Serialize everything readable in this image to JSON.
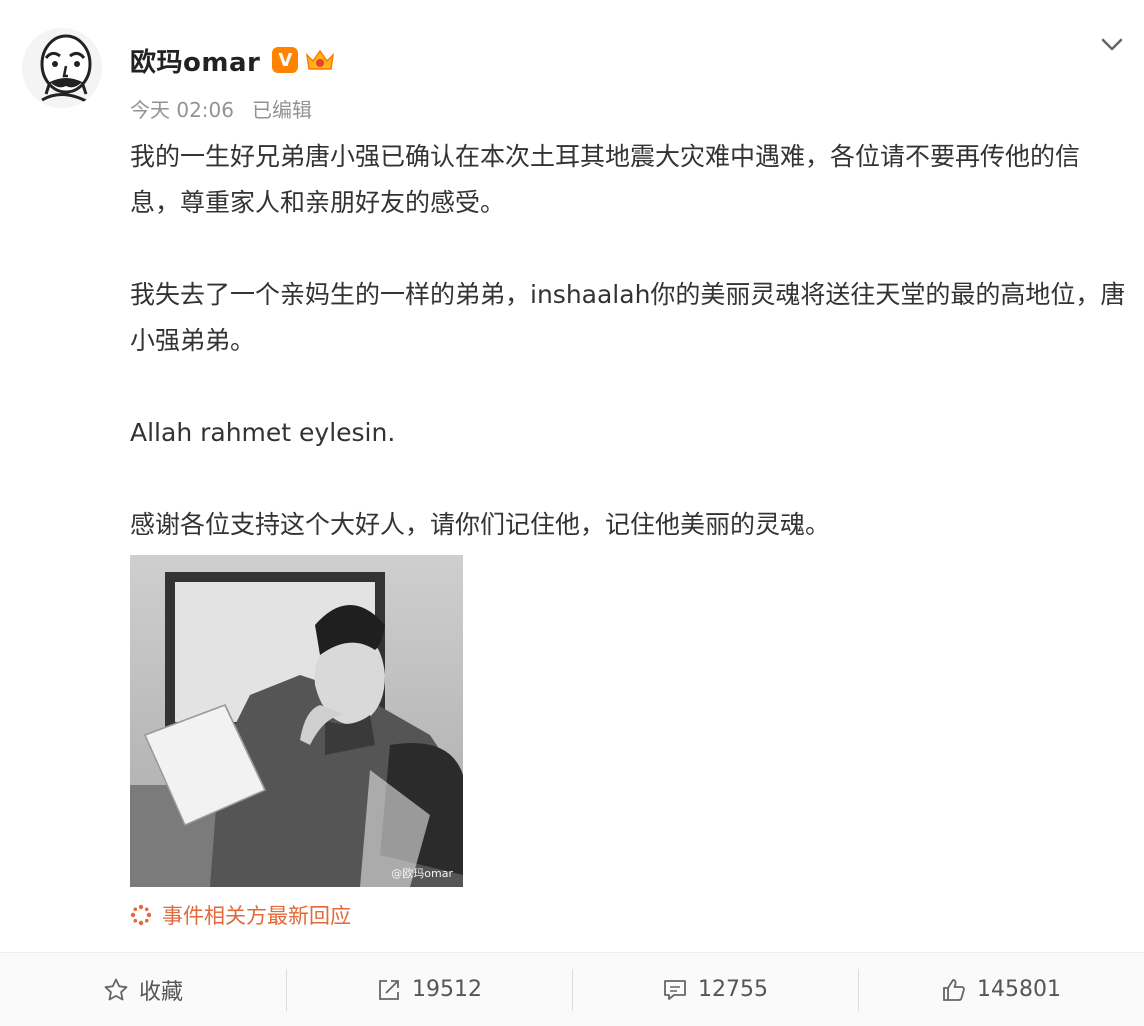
{
  "post": {
    "author": "欧玛omar",
    "verified_badge": "V",
    "time": "今天 02:06",
    "edited": "已编辑",
    "paragraphs": [
      "我的一生好兄弟唐小强已确认在本次土耳其地震大灾难中遇难，各位请不要再传他的信息，尊重家人和亲朋好友的感受。",
      "我失去了一个亲妈生的一样的弟弟，inshaalah你的美丽灵魂将送往天堂的最的高地位，唐小强弟弟。",
      "Allah rahmet eylesin.",
      "感谢各位支持这个大好人，请你们记住他，记住他美丽的灵魂。"
    ],
    "image_watermark": "@欧玛omar",
    "event_link": "事件相关方最新回应"
  },
  "actions": {
    "favorite_label": "收藏",
    "repost_count": "19512",
    "comment_count": "12755",
    "like_count": "145801"
  },
  "icons": {
    "avatar": "cartoon-avatar-icon",
    "menu": "chevron-down-icon",
    "event": "sparkle-icon",
    "favorite": "star-icon",
    "repost": "share-icon",
    "comment": "comment-icon",
    "like": "thumbs-up-icon"
  },
  "colors": {
    "verified": "#ff8200",
    "event_link": "#e2693a",
    "meta_text": "#939393"
  }
}
